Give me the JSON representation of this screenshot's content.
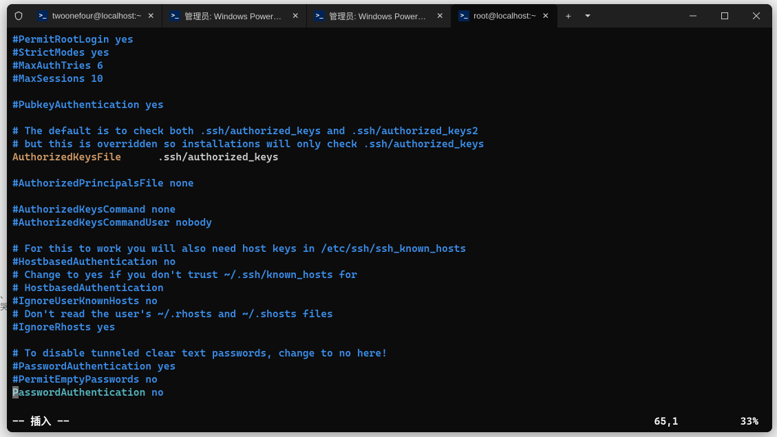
{
  "tabs": [
    {
      "label": "twoonefour@localhost:~",
      "icon": "ps"
    },
    {
      "label": "管理员: Windows PowerShell",
      "icon": "ps"
    },
    {
      "label": "管理员: Windows PowerShell",
      "icon": "ps"
    },
    {
      "label": "root@localhost:~",
      "icon": "ps",
      "active": true
    }
  ],
  "content": {
    "l1": "#PermitRootLogin yes",
    "l2": "#StrictModes yes",
    "l3": "#MaxAuthTries 6",
    "l4": "#MaxSessions 10",
    "l5": "",
    "l6": "#PubkeyAuthentication yes",
    "l7": "",
    "l8": "# The default is to check both .ssh/authorized_keys and .ssh/authorized_keys2",
    "l9": "# but this is overridden so installations will only check .ssh/authorized_keys",
    "l10a": "AuthorizedKeysFile",
    "l10b": "      .ssh/authorized_keys",
    "l11": "",
    "l12": "#AuthorizedPrincipalsFile none",
    "l13": "",
    "l14": "#AuthorizedKeysCommand none",
    "l15": "#AuthorizedKeysCommandUser nobody",
    "l16": "",
    "l17": "# For this to work you will also need host keys in /etc/ssh/ssh_known_hosts",
    "l18": "#HostbasedAuthentication no",
    "l19": "# Change to yes if you don't trust ~/.ssh/known_hosts for",
    "l20": "# HostbasedAuthentication",
    "l21": "#IgnoreUserKnownHosts no",
    "l22": "# Don't read the user's ~/.rhosts and ~/.shosts files",
    "l23": "#IgnoreRhosts yes",
    "l24": "",
    "l25": "# To disable tunneled clear text passwords, change to no here!",
    "l26": "#PasswordAuthentication yes",
    "l27": "#PermitEmptyPasswords no",
    "l28a": "PasswordAuthentication",
    "l28b": " no"
  },
  "status": {
    "mode": "-- 插入 --",
    "position": "65,1",
    "percent": "33%"
  }
}
